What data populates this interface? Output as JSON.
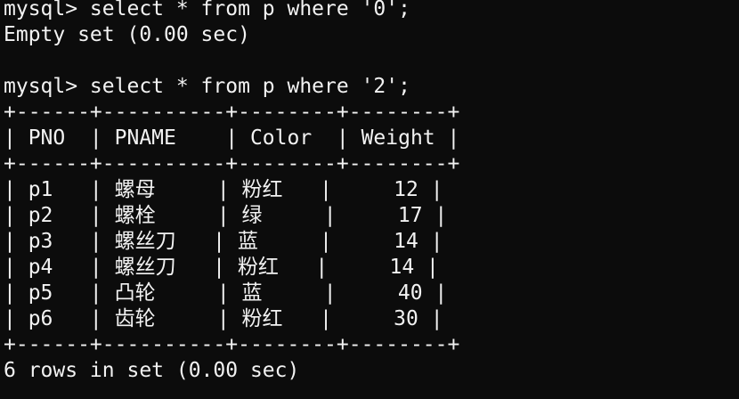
{
  "terminal": {
    "lines": [
      "mysql> select * from p where '0';",
      "Empty set (0.00 sec)",
      "",
      "mysql> select * from p where '2';",
      "+------+----------+--------+--------+",
      "| PNO  | PNAME    | Color  | Weight |",
      "+------+----------+--------+--------+",
      "| p1   | 螺母     | 粉红   |     12 |",
      "| p2   | 螺栓     | 绿     |     17 |",
      "| p3   | 螺丝刀   | 蓝     |     14 |",
      "| p4   | 螺丝刀   | 粉红   |     14 |",
      "| p5   | 凸轮     | 蓝     |     40 |",
      "| p6   | 齿轮     | 粉红   |     30 |",
      "+------+----------+--------+--------+",
      "6 rows in set (0.00 sec)"
    ]
  }
}
